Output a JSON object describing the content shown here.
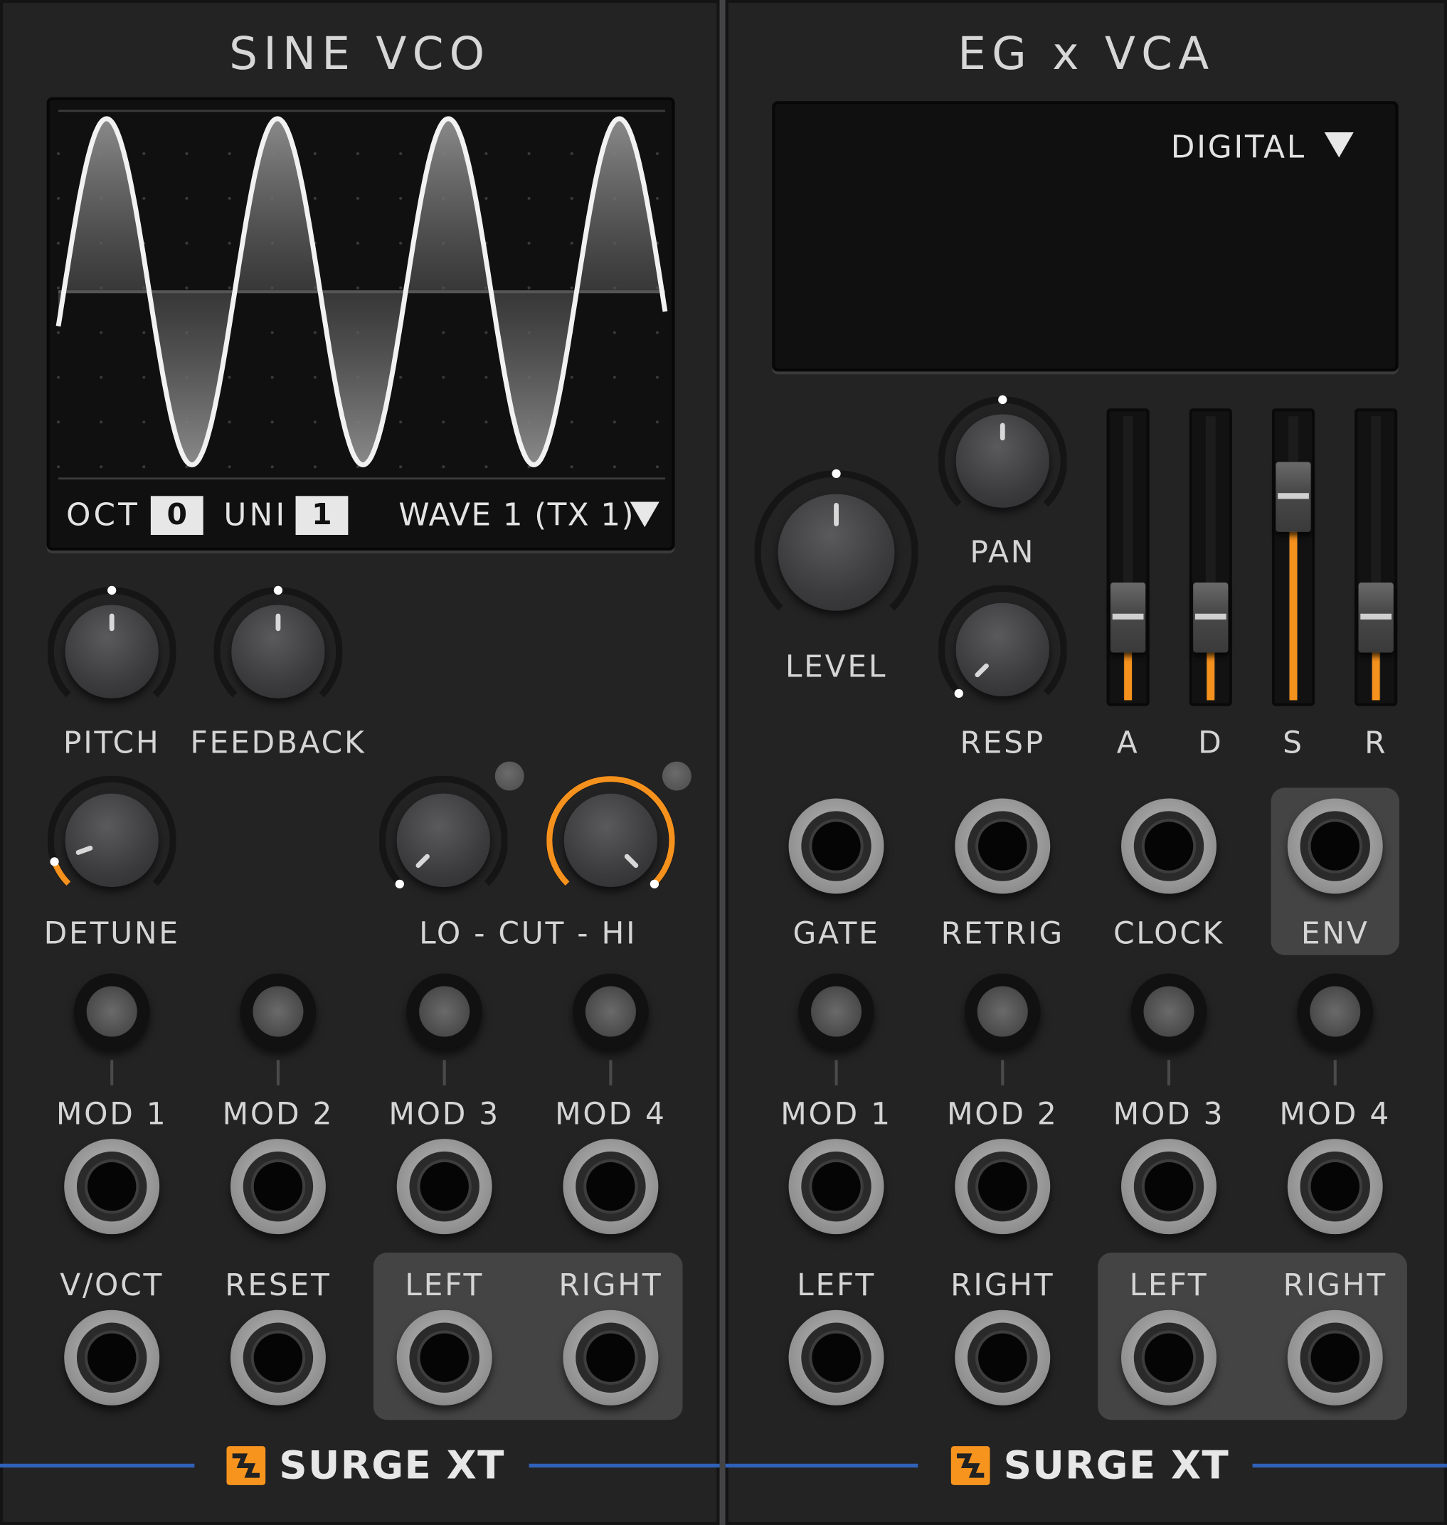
{
  "vco": {
    "title": "SINE VCO",
    "display": {
      "oct_label": "OCT",
      "oct_value": "0",
      "uni_label": "UNI",
      "uni_value": "1",
      "wave": "WAVE 1 (TX 1)"
    },
    "knobs": {
      "pitch": "PITCH",
      "feedback": "FEEDBACK",
      "detune": "DETUNE",
      "locuthi": "LO - CUT - HI"
    },
    "mods": [
      "MOD 1",
      "MOD 2",
      "MOD 3",
      "MOD 4"
    ],
    "inputs": {
      "voct": "V/OCT",
      "reset": "RESET"
    },
    "outputs": {
      "left": "LEFT",
      "right": "RIGHT"
    },
    "brand": "SURGE XT"
  },
  "eg": {
    "title": "EG x VCA",
    "mode": "DIGITAL",
    "knobs": {
      "level": "LEVEL",
      "pan": "PAN",
      "resp": "RESP"
    },
    "sliders": [
      {
        "label": "A",
        "value": 0.22
      },
      {
        "label": "D",
        "value": 0.22
      },
      {
        "label": "S",
        "value": 0.78
      },
      {
        "label": "R",
        "value": 0.22
      }
    ],
    "jacks": {
      "gate": "GATE",
      "retrig": "RETRIG",
      "clock": "CLOCK",
      "env": "ENV"
    },
    "mods": [
      "MOD 1",
      "MOD 2",
      "MOD 3",
      "MOD 4"
    ],
    "inputs": {
      "left": "LEFT",
      "right": "RIGHT"
    },
    "outputs": {
      "left": "LEFT",
      "right": "RIGHT"
    },
    "brand": "SURGE XT"
  },
  "colors": {
    "accent": "#f5911d",
    "footer_line": "#2f62b7",
    "panel": "#232324"
  }
}
